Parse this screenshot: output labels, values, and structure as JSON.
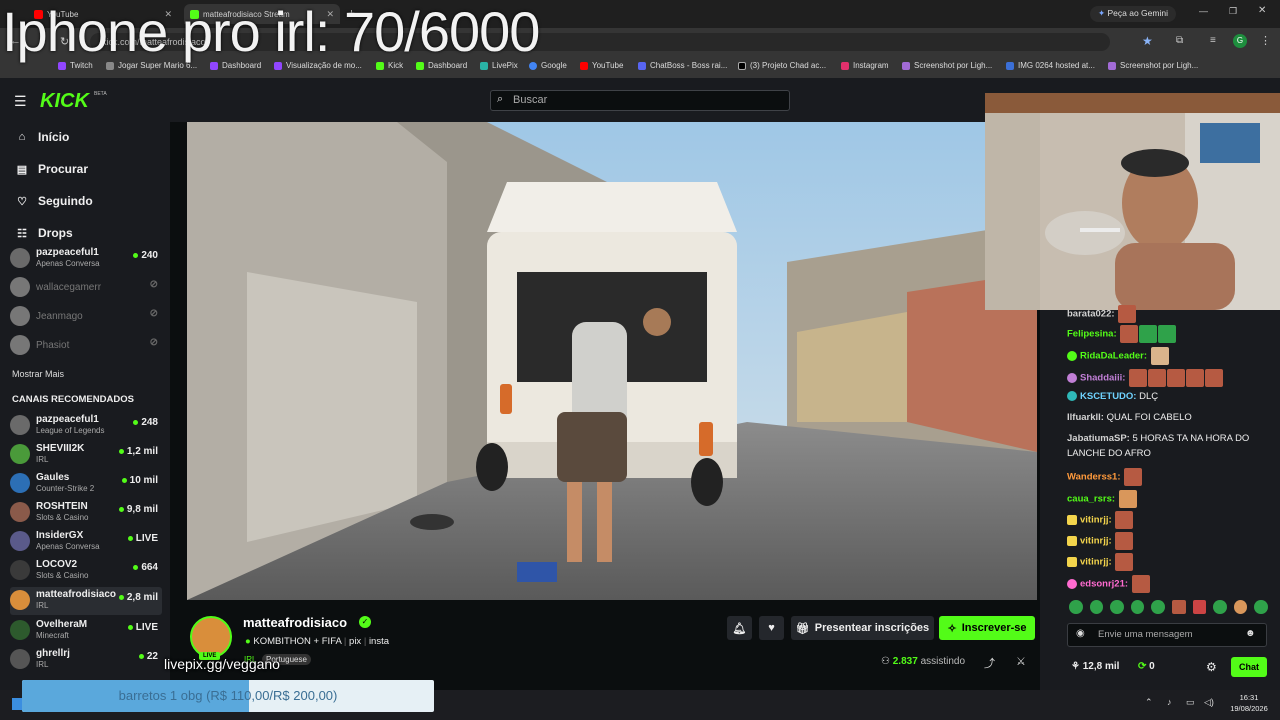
{
  "overlay": {
    "title": "Iphone pro irl: 70/6000",
    "livepix": "livepix.gg/veggano",
    "goal_text": "barretos 1 obg (R$ 110,00/R$ 200,00)",
    "goal_progress": 0.55
  },
  "browser": {
    "tabs": [
      {
        "label": "YouTube"
      },
      {
        "label": "matteafrodisiaco Stream"
      }
    ],
    "new_tab": "+",
    "gemini_button": "Peça ao Gemini",
    "url": "kick.com/matteafrodisiaco",
    "bookmarks": [
      "Twitch",
      "Jogar Super Mario 6...",
      "Dashboard",
      "Visualização de mo...",
      "Kick",
      "Dashboard",
      "LivePix",
      "Google",
      "YouTube",
      "ChatBoss - Boss rai...",
      "(3) Projeto Chad ac...",
      "Instagram",
      "Screenshot por Ligh...",
      "IMG 0264 hosted at...",
      "Screenshot por Ligh..."
    ]
  },
  "kick": {
    "logo": "KICK",
    "beta": "BETA",
    "search_placeholder": "Buscar",
    "nav": [
      {
        "label": "Início",
        "icon": "home-icon"
      },
      {
        "label": "Procurar",
        "icon": "browse-icon"
      },
      {
        "label": "Seguindo",
        "icon": "heart-icon"
      },
      {
        "label": "Drops",
        "icon": "drops-icon"
      }
    ],
    "following": [
      {
        "name": "pazpeaceful1",
        "category": "Apenas Conversa",
        "viewers": "240",
        "live": true
      },
      {
        "name": "wallacegamerr",
        "live": false
      },
      {
        "name": "Jeanmago",
        "live": false
      },
      {
        "name": "Phasiot",
        "live": false
      }
    ],
    "show_more": "Mostrar Mais",
    "recommended_title": "CANAIS RECOMENDADOS",
    "recommended": [
      {
        "name": "pazpeaceful1",
        "category": "League of Legends",
        "viewers": "248"
      },
      {
        "name": "SHEVIII2K",
        "category": "IRL",
        "viewers": "1,2 mil"
      },
      {
        "name": "Gaules",
        "category": "Counter-Strike 2",
        "viewers": "10 mil"
      },
      {
        "name": "ROSHTEIN",
        "category": "Slots & Casino",
        "viewers": "9,8 mil"
      },
      {
        "name": "InsiderGX",
        "category": "Apenas Conversa",
        "viewers": "LIVE"
      },
      {
        "name": "LOCOV2",
        "category": "Slots & Casino",
        "viewers": "664"
      },
      {
        "name": "matteafrodisiaco",
        "category": "IRL",
        "viewers": "2,8 mil"
      },
      {
        "name": "OvelheraM",
        "category": "Minecraft",
        "viewers": "LIVE"
      },
      {
        "name": "ghrellrj",
        "category": "IRL",
        "viewers": "22"
      }
    ]
  },
  "stream": {
    "streamer": "matteafrodisiaco",
    "live_badge": "LIVE",
    "title_parts": [
      "KOMBITHON + FIFA",
      "pix",
      "insta"
    ],
    "category": "IRL",
    "language": "Portuguese",
    "viewers": "2.837",
    "viewers_label": "assistindo",
    "gift_button": "Presentear inscrições",
    "subscribe_button": "Inscrever-se"
  },
  "chat": {
    "messages": [
      {
        "user": "barata022:",
        "text": "",
        "emotes": 1,
        "color": "#d2d2d2"
      },
      {
        "user": "Felipesina:",
        "text": "",
        "emotes": 3,
        "color": "#53fc18"
      },
      {
        "user": "RidaDaLeader:",
        "text": "",
        "emotes": 1,
        "color": "#53fc18"
      },
      {
        "user": "Shaddaiii:",
        "text": "",
        "emotes": 5,
        "color": "#c17fd6"
      },
      {
        "user": "KSCETUDO:",
        "text": "DLÇ",
        "emotes": 0,
        "color": "#6fd3ff"
      },
      {
        "user": "Ilfuarkll:",
        "text": "QUAL FOI CABELO",
        "emotes": 0,
        "color": "#d2d2d2"
      },
      {
        "user": "JabatiumaSP:",
        "text": "5 HORAS TA NA HORA DO",
        "emotes": 0,
        "color": "#d2d2d2"
      },
      {
        "user": "",
        "text": "LANCHE DO AFRO",
        "emotes": 0,
        "color": "#d2d2d2"
      },
      {
        "user": "Wanderss1:",
        "text": "",
        "emotes": 1,
        "color": "#ff9a3c"
      },
      {
        "user": "caua_rsrs:",
        "text": "",
        "emotes": 1,
        "color": "#53fc18"
      },
      {
        "user": "vitinrjj:",
        "text": "",
        "emotes": 1,
        "color": "#f3d44c"
      },
      {
        "user": "vitinrjj:",
        "text": "",
        "emotes": 1,
        "color": "#f3d44c"
      },
      {
        "user": "vitinrjj:",
        "text": "",
        "emotes": 1,
        "color": "#f3d44c"
      },
      {
        "user": "edsonrj21:",
        "text": "",
        "emotes": 1,
        "color": "#ff6bd0"
      }
    ],
    "input_placeholder": "Envie uma mensagem",
    "points": "12,8 mil",
    "kicks": "0",
    "chat_button": "Chat"
  },
  "taskbar": {
    "time": "16:31",
    "date": "19/08/2026"
  }
}
